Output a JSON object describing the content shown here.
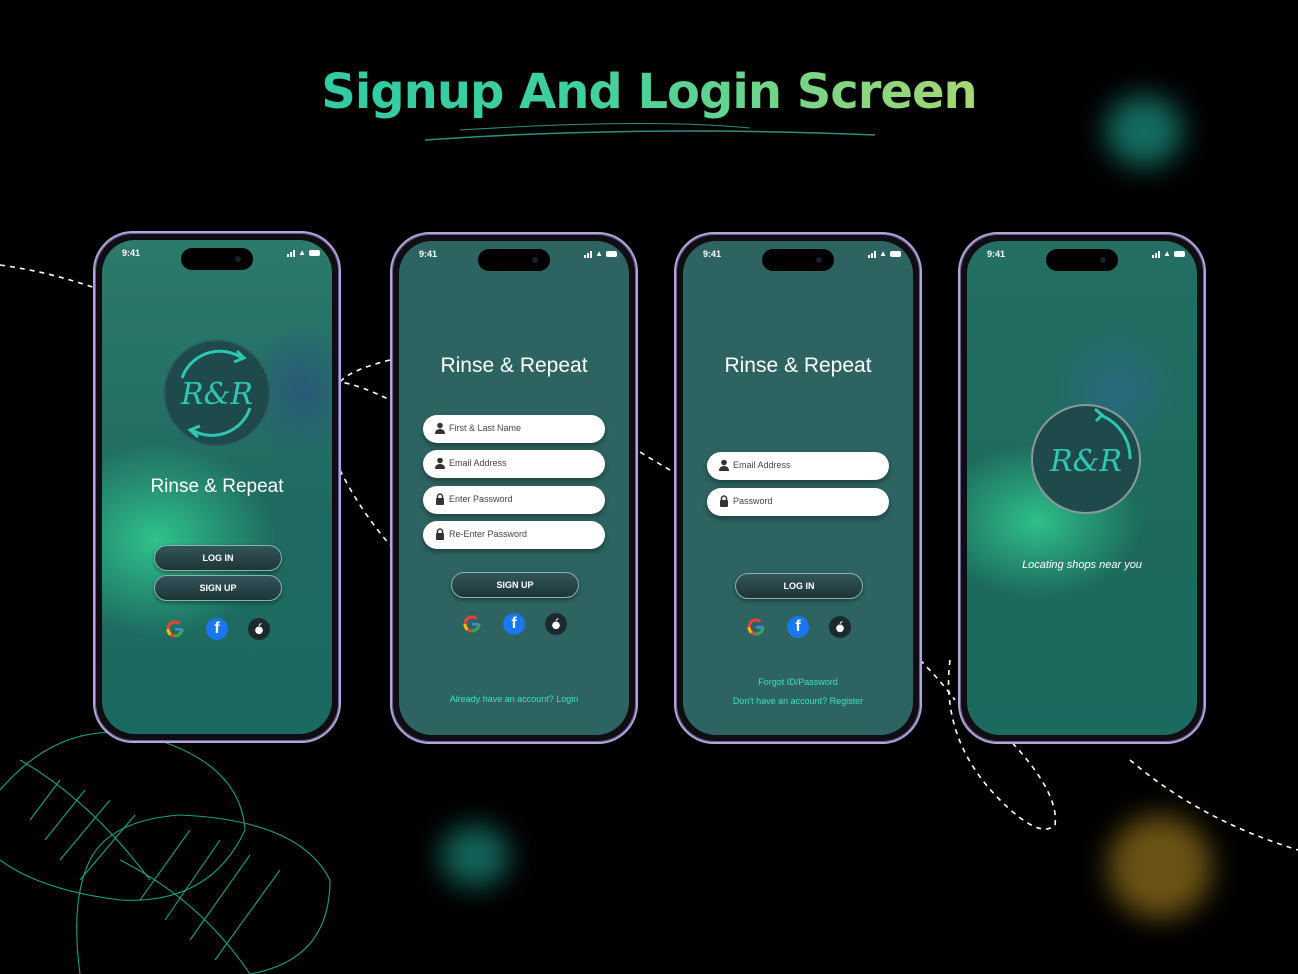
{
  "page": {
    "title": "Signup And Login Screen"
  },
  "status": {
    "time": "9:41"
  },
  "brand": {
    "name": "Rinse & Repeat",
    "logo_text": "R&R"
  },
  "screen1": {
    "login_button": "LOG IN",
    "signup_button": "SIGN UP"
  },
  "screen2": {
    "fields": {
      "name": "First & Last Name",
      "email": "Email Address",
      "password": "Enter Password",
      "password_confirm": "Re-Enter Password"
    },
    "signup_button": "SIGN UP",
    "login_link": "Already have an account? Login"
  },
  "screen3": {
    "fields": {
      "email": "Email Address",
      "password": "Password"
    },
    "login_button": "LOG IN",
    "forgot_link": "Forgot ID/Password",
    "register_link": "Don't have an account? Register"
  },
  "screen4": {
    "loading_text": "Locating shops near you"
  },
  "social": [
    "google-icon",
    "facebook-icon",
    "apple-icon"
  ],
  "colors": {
    "title_gradient_start": "#1fc4a8",
    "title_gradient_end": "#d8dc62",
    "screen_teal": "#2c6b63",
    "link_teal": "#3ee0c0",
    "phone_frame": "#b6a5dc"
  }
}
